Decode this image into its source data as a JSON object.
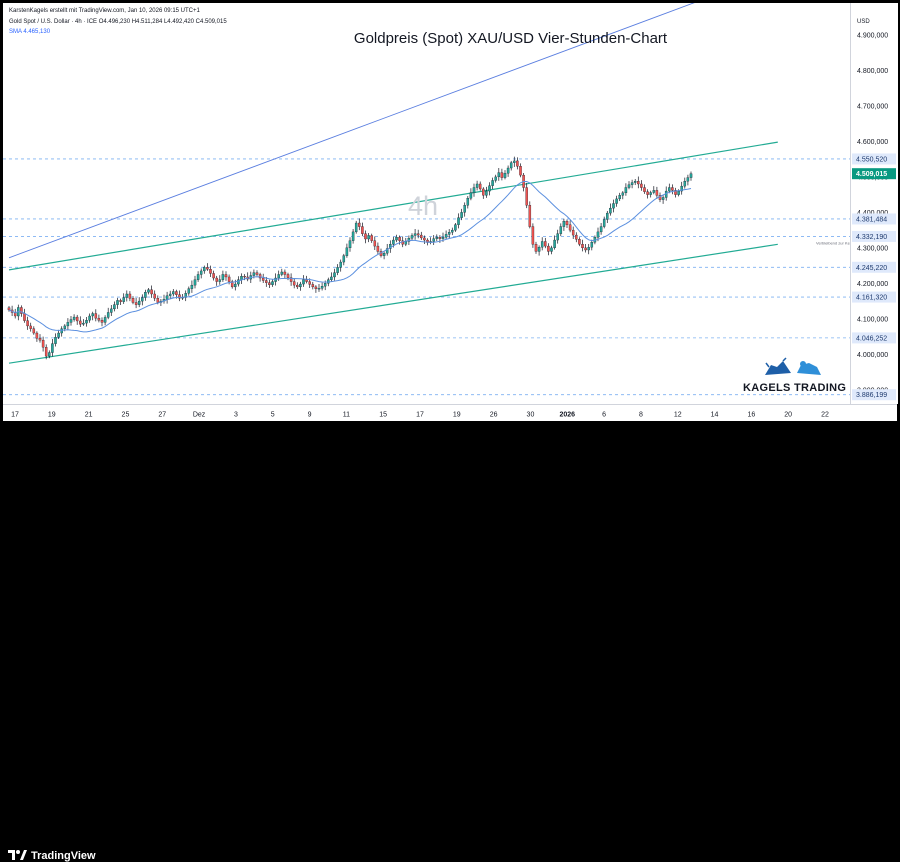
{
  "header": {
    "credit": "KarstenKagels erstellt mit TradingView.com, Jan 10, 2026 09:15 UTC+1",
    "ohlc": "Gold Spot / U.S. Dollar · 4h · ICE   O4.496,230  H4.511,284  L4.492,420  C4.509,015",
    "sma_prefix": "SMA",
    "sma_value": "4.465,130"
  },
  "title": "Goldpreis (Spot) XAU/USD Vier-Stunden-Chart",
  "watermark": "4h",
  "brand": "KAGELS TRADING",
  "footer": {
    "logo": "TradingView"
  },
  "currency": "USD",
  "colors": {
    "up": "#26a69a",
    "down": "#ef5350",
    "wick": "#131722",
    "channel": "#22ab94",
    "upper_line": "#5b7fe0",
    "sma": "#5c90df",
    "level_line": "#7eb1f2",
    "level_label_bg": "#dfe9fb",
    "current_label_bg": "#089981",
    "countdown_label": "Verbleibend zur Kerze"
  },
  "chart_data": {
    "type": "candlestick",
    "title": "Goldpreis (Spot) XAU/USD Vier-Stunden-Chart",
    "symbol": "XAU/USD",
    "timeframe": "4h",
    "y_unit": "USD",
    "ylim": [
      3860,
      4990
    ],
    "x_ticks": [
      "17",
      "19",
      "21",
      "25",
      "27",
      "Dez",
      "3",
      "5",
      "9",
      "11",
      "15",
      "17",
      "19",
      "26",
      "30",
      "2026",
      "6",
      "8",
      "12",
      "14",
      "16",
      "20",
      "22"
    ],
    "y_ticks": [
      3900,
      4000,
      4100,
      4200,
      4300,
      4400,
      4500,
      4600,
      4700,
      4800,
      4900
    ],
    "price_levels": [
      {
        "value": 4550.52,
        "label": "4.550,520"
      },
      {
        "value": 4381.484,
        "label": "4.381,484"
      },
      {
        "value": 4332.19,
        "label": "4.332,190"
      },
      {
        "value": 4245.22,
        "label": "4.245,220"
      },
      {
        "value": 4161.32,
        "label": "4.161,320"
      },
      {
        "value": 4046.252,
        "label": "4.046,252"
      },
      {
        "value": 3886.199,
        "label": "3.886,199"
      }
    ],
    "current_price": {
      "value": 4509.015,
      "label": "4.509,015"
    },
    "indicator": {
      "name": "SMA",
      "value": 4465.13
    },
    "trendlines": [
      {
        "role": "upper",
        "from": {
          "bar": 0,
          "y": 4272
        },
        "to": {
          "bar": 230,
          "y": 5020
        }
      },
      {
        "role": "channel-top",
        "from": {
          "bar": 0,
          "y": 4238
        },
        "to": {
          "bar": 248,
          "y": 4598
        }
      },
      {
        "role": "channel-bottom",
        "from": {
          "bar": 0,
          "y": 3975
        },
        "to": {
          "bar": 248,
          "y": 4310
        }
      }
    ],
    "closes": [
      4125,
      4118,
      4108,
      4132,
      4115,
      4095,
      4080,
      4072,
      4060,
      4045,
      4040,
      4020,
      3995,
      4005,
      4030,
      4048,
      4060,
      4072,
      4080,
      4090,
      4098,
      4105,
      4094,
      4085,
      4088,
      4096,
      4108,
      4115,
      4102,
      4096,
      4090,
      4104,
      4118,
      4128,
      4140,
      4152,
      4148,
      4160,
      4170,
      4158,
      4146,
      4140,
      4150,
      4160,
      4175,
      4182,
      4170,
      4158,
      4146,
      4150,
      4155,
      4165,
      4170,
      4177,
      4168,
      4158,
      4160,
      4172,
      4185,
      4195,
      4210,
      4225,
      4235,
      4245,
      4240,
      4228,
      4215,
      4205,
      4210,
      4225,
      4218,
      4205,
      4190,
      4198,
      4210,
      4220,
      4218,
      4212,
      4222,
      4230,
      4225,
      4215,
      4208,
      4202,
      4196,
      4205,
      4215,
      4225,
      4232,
      4225,
      4216,
      4205,
      4195,
      4190,
      4198,
      4210,
      4205,
      4197,
      4190,
      4185,
      4186,
      4192,
      4200,
      4210,
      4218,
      4230,
      4245,
      4260,
      4278,
      4300,
      4320,
      4345,
      4370,
      4360,
      4340,
      4325,
      4335,
      4320,
      4305,
      4290,
      4278,
      4285,
      4298,
      4310,
      4322,
      4330,
      4320,
      4310,
      4318,
      4327,
      4335,
      4340,
      4336,
      4328,
      4322,
      4315,
      4318,
      4326,
      4330,
      4326,
      4330,
      4338,
      4344,
      4350,
      4365,
      4385,
      4400,
      4420,
      4440,
      4455,
      4470,
      4480,
      4466,
      4448,
      4460,
      4475,
      4490,
      4500,
      4512,
      4498,
      4510,
      4525,
      4540,
      4545,
      4530,
      4505,
      4470,
      4420,
      4360,
      4310,
      4290,
      4302,
      4318,
      4305,
      4290,
      4300,
      4322,
      4340,
      4360,
      4375,
      4365,
      4350,
      4336,
      4324,
      4310,
      4300,
      4294,
      4302,
      4316,
      4330,
      4345,
      4360,
      4380,
      4398,
      4412,
      4425,
      4438,
      4448,
      4455,
      4470,
      4478,
      4484,
      4488,
      4480,
      4470,
      4458,
      4450,
      4456,
      4462,
      4448,
      4436,
      4442,
      4460,
      4470,
      4462,
      4450,
      4460,
      4474,
      4488,
      4498,
      4509
    ]
  }
}
